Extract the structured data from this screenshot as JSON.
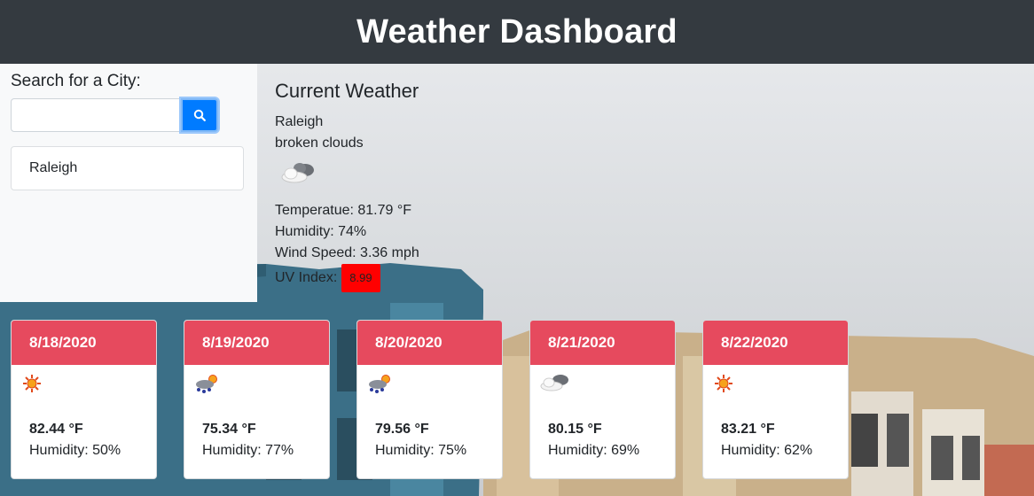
{
  "header": {
    "title": "Weather Dashboard"
  },
  "search": {
    "label": "Search for a City:",
    "value": "",
    "placeholder": ""
  },
  "history": [
    "Raleigh"
  ],
  "current": {
    "heading": "Current Weather",
    "city": "Raleigh",
    "description": "broken clouds",
    "icon": "broken-clouds-icon",
    "temperature": "Temperatue: 81.79 °F",
    "humidity": "Humidity: 74%",
    "wind": "Wind Speed: 3.36 mph",
    "uv_label": "UV Index:",
    "uv_value": "8.99",
    "uv_color": "#ff0000"
  },
  "forecast": [
    {
      "date": "8/18/2020",
      "icon": "sun-icon",
      "temp": "82.44 °F",
      "humidity": "Humidity: 50%"
    },
    {
      "date": "8/19/2020",
      "icon": "rain-sun-icon",
      "temp": "75.34 °F",
      "humidity": "Humidity: 77%"
    },
    {
      "date": "8/20/2020",
      "icon": "rain-sun-icon",
      "temp": "79.56 °F",
      "humidity": "Humidity: 75%"
    },
    {
      "date": "8/21/2020",
      "icon": "cloud-icon",
      "temp": "80.15 °F",
      "humidity": "Humidity: 69%"
    },
    {
      "date": "8/22/2020",
      "icon": "sun-icon",
      "temp": "83.21 °F",
      "humidity": "Humidity: 62%"
    }
  ],
  "colors": {
    "header_bg": "#343a40",
    "card_header": "#e64a5e",
    "search_button": "#007bff"
  }
}
